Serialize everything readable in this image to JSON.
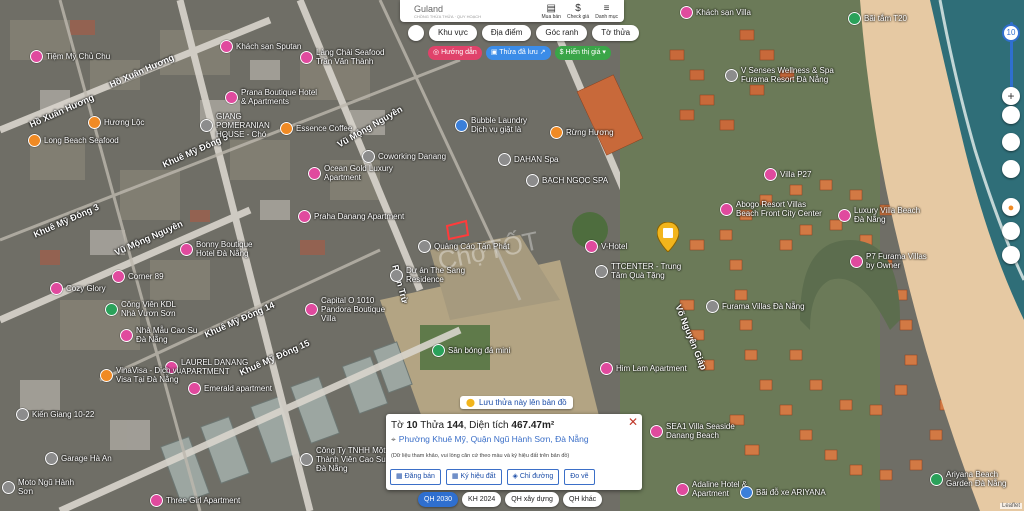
{
  "brand": {
    "name": "Guland",
    "tagline": "CHỒNG THỬA THỬA · QUY HOẠCH"
  },
  "top_menu": [
    {
      "label": "Mua bán",
      "icon": "store-icon"
    },
    {
      "label": "Check giá",
      "icon": "dollar-icon"
    },
    {
      "label": "Danh mục",
      "icon": "menu-icon"
    }
  ],
  "chips": [
    "Khu vực",
    "Địa điểm",
    "Góc ranh",
    "Tờ thửa"
  ],
  "actions": {
    "directions": "Hướng dẫn",
    "saved": "Thửa đã lưu",
    "price": "$ Hiển thị giá"
  },
  "zoom": {
    "level": "10"
  },
  "roads": [
    {
      "label": "Hồ Xuân Hương"
    },
    {
      "label": "Hồ Xuân Hương"
    },
    {
      "label": "Vũ Mộng Nguyên"
    },
    {
      "label": "Khuê Mỹ Đông 5"
    },
    {
      "label": "Khuê Mỹ Đông 3"
    },
    {
      "label": "Vũ Mộng Nguyên"
    },
    {
      "label": "Khuê Mỹ Đông 14"
    },
    {
      "label": "Khuê Mỹ Đông 15"
    },
    {
      "label": "Võ Nguyên Giáp"
    },
    {
      "label": "Phan Trừ"
    }
  ],
  "pois": [
    {
      "label": "Tiệm Mỳ Chủ Chu",
      "color": "pink"
    },
    {
      "label": "Khách sạn Sputan",
      "color": "pink"
    },
    {
      "label": "Làng Chài Seafood Trần Văn Thành",
      "color": "pink"
    },
    {
      "label": "Prana Boutique Hotel & Apartments",
      "color": "pink"
    },
    {
      "label": "Hương Lộc",
      "color": "orange"
    },
    {
      "label": "GIANG POMERANIAN HOUSE - Chó",
      "color": "gray"
    },
    {
      "label": "Essence Coffee",
      "color": "orange"
    },
    {
      "label": "Bubble Laundry Dịch vụ giặt là",
      "color": "blue"
    },
    {
      "label": "Long Beach Seafood",
      "color": "orange"
    },
    {
      "label": "Rừng Hương",
      "color": "orange"
    },
    {
      "label": "Coworking Danang",
      "color": "gray"
    },
    {
      "label": "DAHAN Spa",
      "color": "gray"
    },
    {
      "label": "Ocean Gold Luxury Apartment",
      "color": "pink"
    },
    {
      "label": "BẠCH NGỌC SPA",
      "color": "gray"
    },
    {
      "label": "Praha Danang Apartment",
      "color": "pink"
    },
    {
      "label": "Quảng Cáo Tấn Phát",
      "color": "gray"
    },
    {
      "label": "V-Hotel",
      "color": "pink"
    },
    {
      "label": "Bonny Boutique Hotel Đà Nẵng",
      "color": "pink"
    },
    {
      "label": "Corner 89",
      "color": "pink"
    },
    {
      "label": "Dự án The Sang Residence",
      "color": "gray"
    },
    {
      "label": "Cozy Glory",
      "color": "pink"
    },
    {
      "label": "Capital O 1010 Pandora Boutique Villa",
      "color": "pink"
    },
    {
      "label": "Công Viên KDL Nhà Vươn Sơn",
      "color": "green"
    },
    {
      "label": "Nhà Mẫu Cao Su Đà Nẵng",
      "color": "pink"
    },
    {
      "label": "Sân bóng đá mini",
      "color": "green"
    },
    {
      "label": "LAUREL DANANG APARTMENT",
      "color": "pink"
    },
    {
      "label": "VinaVisa - Dịch vụ Visa Tại Đà Nẵng",
      "color": "orange"
    },
    {
      "label": "Emerald apartment",
      "color": "pink"
    },
    {
      "label": "Him Lam Apartment",
      "color": "pink"
    },
    {
      "label": "Kiến Giang 10-22",
      "color": "gray"
    },
    {
      "label": "Garage Hà An",
      "color": "gray"
    },
    {
      "label": "Công Ty TNHH Một Thành Viên Cao Su Đà Nẵng",
      "color": "gray"
    },
    {
      "label": "Three Girl Apartment",
      "color": "pink"
    },
    {
      "label": "Moto Ngũ Hành Sơn",
      "color": "gray"
    },
    {
      "label": "SEA1 Villa Seaside Danang Beach",
      "color": "pink"
    },
    {
      "label": "Adaline Hotel & Apartment",
      "color": "pink"
    },
    {
      "label": "Bãi đỗ xe ARIYANA",
      "color": "blue"
    },
    {
      "label": "Ariyana Beach Garden Đà Nẵng",
      "color": "green"
    },
    {
      "label": "TTCENTER - Trung Tâm Quà Tặng",
      "color": "gray"
    },
    {
      "label": "Furama Villas Đà Nẵng",
      "color": "gray"
    },
    {
      "label": "Abogo Resort Villas Beach Front City Center",
      "color": "pink"
    },
    {
      "label": "Luxury Villa Beach Đà Nẵng",
      "color": "pink"
    },
    {
      "label": "Villa P27",
      "color": "pink"
    },
    {
      "label": "P7 Furama Villas by Owner",
      "color": "pink"
    },
    {
      "label": "V Senses Wellness & Spa Furama Resort Đà Nẵng",
      "color": "gray"
    },
    {
      "label": "Bãi tắm T20",
      "color": "green"
    },
    {
      "label": "Khách sạn Villa",
      "color": "pink"
    }
  ],
  "save_banner": "Lưu thửa này lên bản đồ",
  "parcel": {
    "prefix": "Tờ",
    "sheet": "10",
    "lot_label": "Thửa",
    "lot": "144",
    "area_label": "Diện tích",
    "area": "467.47m²",
    "ward": "Phường Khuê Mỹ",
    "district": "Quận Ngũ Hành Sơn",
    "city": "Đà Nẵng",
    "note": "(Dữ liệu tham khảo, vui lòng căn cứ theo màu và ký hiệu đất trên bản đồ)",
    "buttons": [
      "Đăng bán",
      "Ký hiệu đất",
      "Chỉ đường",
      "Đo vẽ"
    ]
  },
  "bottom_tabs": [
    "QH 2030",
    "KH 2024",
    "QH xây dựng",
    "QH khác"
  ],
  "attribution": "Leaflet"
}
